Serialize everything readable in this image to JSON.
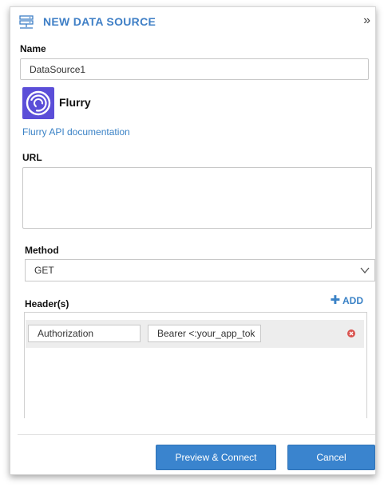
{
  "header": {
    "title": "NEW DATA SOURCE",
    "collapse_glyph": "»",
    "icon": "datasource-server-icon"
  },
  "form": {
    "name_label": "Name",
    "name_value": "DataSource1",
    "provider": {
      "name": "Flurry",
      "icon": "flurry-logo",
      "doc_link": "Flurry API documentation"
    },
    "url_label": "URL",
    "url_value": "",
    "method_label": "Method",
    "method_value": "GET",
    "headers_label": "Header(s)",
    "add_label": "ADD",
    "headers": [
      {
        "key": "Authorization",
        "value": "Bearer <:your_app_tok"
      }
    ]
  },
  "footer": {
    "preview_label": "Preview & Connect",
    "cancel_label": "Cancel"
  },
  "colors": {
    "accent": "#3f7fc6",
    "button": "#3a84ce",
    "flurry_logo": "#5b4ed8",
    "remove": "#d9534f"
  }
}
